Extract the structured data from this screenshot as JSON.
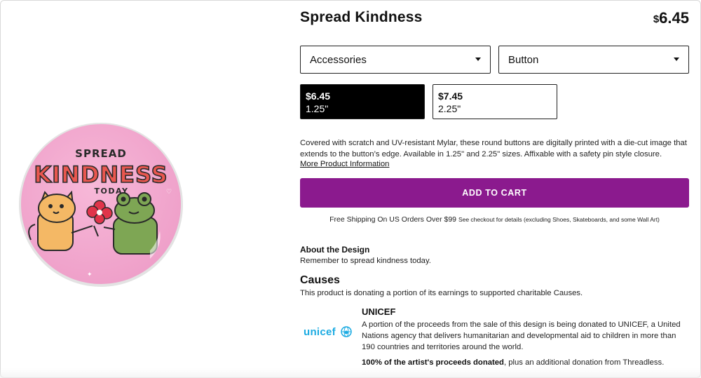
{
  "product": {
    "title": "Spread Kindness",
    "price_currency": "$",
    "price_value": "6.45",
    "image": {
      "text_line1": "SPREAD",
      "text_line2": "KINDNESS",
      "text_line3": "TODAY",
      "colors": {
        "background": "#f3a9cf",
        "cat": "#f4b865",
        "frog": "#7ea654",
        "flower": "#e0344a"
      }
    }
  },
  "selectors": {
    "category": "Accessories",
    "style": "Button"
  },
  "sizes": [
    {
      "price": "$6.45",
      "size": "1.25\"",
      "selected": true
    },
    {
      "price": "$7.45",
      "size": "2.25\"",
      "selected": false
    }
  ],
  "description": "Covered with scratch and UV-resistant Mylar, these round buttons are digitally printed with a die-cut image that extends to the button’s edge. Available in 1.25\" and 2.25\" sizes. Affixable with a safety pin style closure.",
  "more_info_link": "More Product Information",
  "add_to_cart": "ADD TO CART",
  "shipping": {
    "main": "Free Shipping On US Orders Over $99",
    "small": "See checkout for details (excluding Shoes, Skateboards, and some Wall Art)"
  },
  "about": {
    "heading": "About the Design",
    "text": "Remember to spread kindness today."
  },
  "causes": {
    "heading": "Causes",
    "text": "This product is donating a portion of its earnings to supported charitable Causes.",
    "items": [
      {
        "logo_text": "unicef",
        "name": "UNICEF",
        "description": "A portion of the proceeds from the sale of this design is being donated to UNICEF, a United Nations agency that delivers humanitarian and developmental aid to children in more than 190 countries and territories around the world.",
        "note_bold": "100% of the artist's proceeds donated",
        "note_rest": ", plus an additional donation from Threadless."
      }
    ]
  },
  "colors": {
    "accent": "#8b1a8e",
    "unicef_blue": "#1cabe2"
  }
}
